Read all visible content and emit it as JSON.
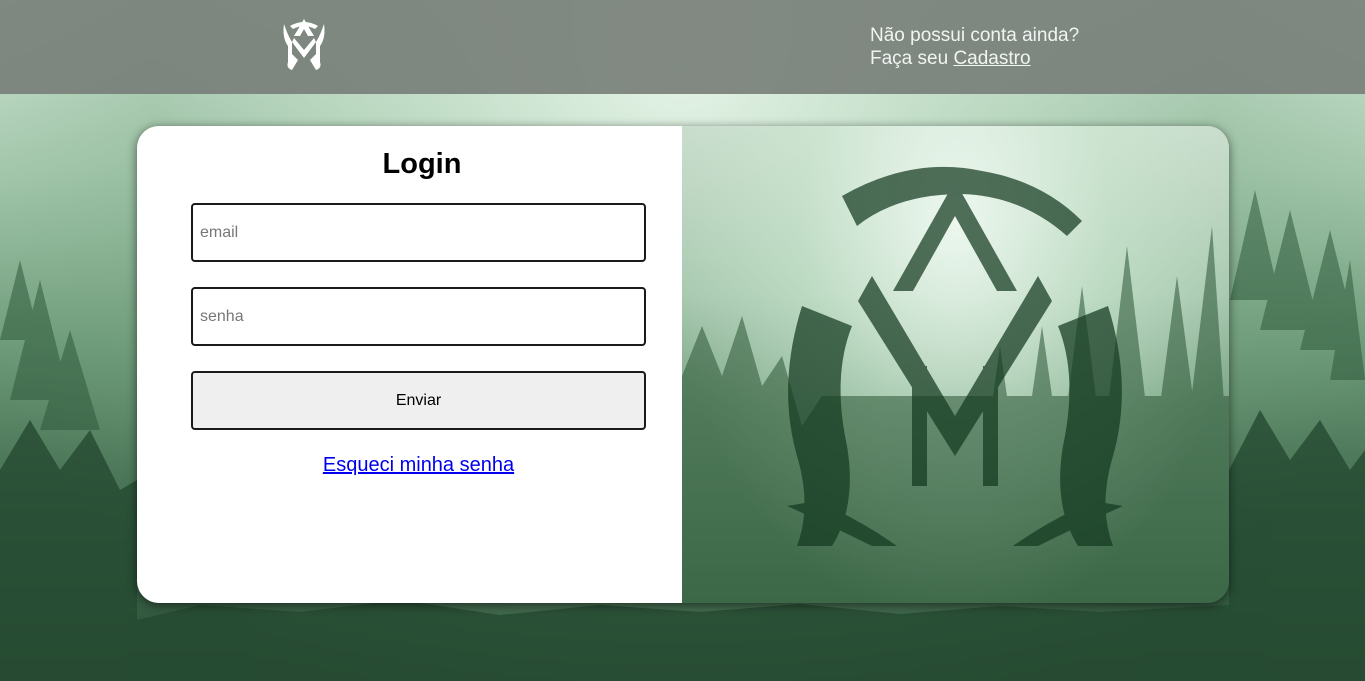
{
  "header": {
    "logo_icon": "mask-logo-icon",
    "signup_line1": "Não possui conta ainda?",
    "signup_prefix": "Faça seu ",
    "signup_link": "Cadastro"
  },
  "login": {
    "title": "Login",
    "email_placeholder": "email",
    "password_placeholder": "senha",
    "submit_label": "Enviar",
    "forgot_label": "Esqueci minha senha"
  },
  "colors": {
    "header_bg": "#78807a",
    "link": "#0000ee",
    "button_bg": "#efefef"
  }
}
